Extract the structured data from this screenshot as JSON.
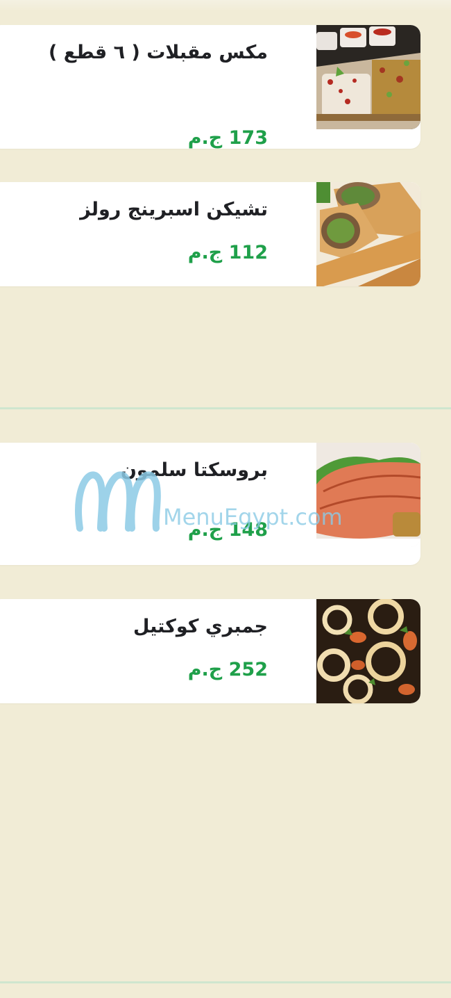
{
  "menu": {
    "items": [
      {
        "name": "مكس مقبلات ( ٦ قطع )",
        "price": "173 ج.م",
        "image_icon": "appetizer-mix-image"
      },
      {
        "name": "تشيكن اسبرينج رولز",
        "price": "112 ج.م",
        "image_icon": "spring-rolls-image"
      },
      {
        "name": "بروسكتا سلمون",
        "price": "148 ج.م",
        "image_icon": "salmon-image"
      },
      {
        "name": "جمبري كوكتيل",
        "price": "252 ج.م",
        "image_icon": "shrimp-cocktail-image"
      }
    ]
  },
  "watermark": {
    "text": "MenuEgypt.com"
  },
  "colors": {
    "background": "#fbf7e6",
    "price": "#1fa04a",
    "title": "#1f2024",
    "divider": "#cfe6cf",
    "watermark": "#7ec3e0"
  }
}
